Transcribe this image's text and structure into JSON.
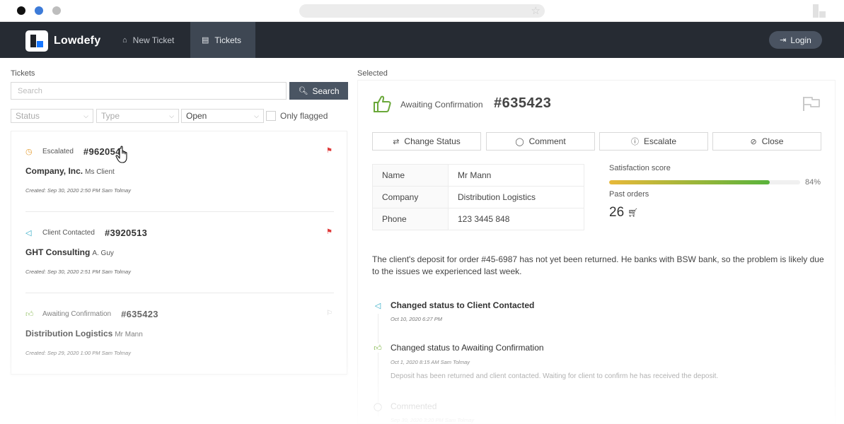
{
  "nav": {
    "brand": "Lowdefy",
    "items": [
      {
        "label": "New Ticket",
        "icon": "house-icon"
      },
      {
        "label": "Tickets",
        "icon": "document-icon"
      }
    ],
    "login_label": "Login"
  },
  "left": {
    "section_label": "Tickets",
    "search": {
      "placeholder": "Search",
      "button_label": "Search"
    },
    "filters": {
      "status_placeholder": "Status",
      "type_placeholder": "Type",
      "state_value": "Open",
      "only_flagged_label": "Only flagged"
    },
    "tickets": [
      {
        "status": "Escalated",
        "status_icon": "clock-icon",
        "status_color": "#e6a23c",
        "number": "#962054",
        "company": "Company, Inc.",
        "contact": "Ms Client",
        "created": "Created: Sep 30, 2020 2:50 PM Sam Tolmay",
        "flag_color": "#e03b3b"
      },
      {
        "status": "Client Contacted",
        "status_icon": "megaphone-icon",
        "status_color": "#2aa8c4",
        "number": "#3920513",
        "company": "GHT Consulting",
        "contact": "A. Guy",
        "created": "Created: Sep 30, 2020 2:51 PM Sam Tolmay",
        "flag_color": "#e03b3b"
      },
      {
        "status": "Awaiting Confirmation",
        "status_icon": "thumbs-up-icon",
        "status_color": "#7cb342",
        "number": "#635423",
        "company": "Distribution Logistics",
        "contact": "Mr Mann",
        "created": "Created: Sep 29, 2020 1:00 PM Sam Tolmay",
        "flag_color": "#bdbdbd"
      }
    ]
  },
  "right": {
    "section_label": "Selected",
    "status": "Awaiting Confirmation",
    "number": "#635423",
    "actions": [
      {
        "label": "Change Status",
        "icon": "swap-icon"
      },
      {
        "label": "Comment",
        "icon": "comment-icon"
      },
      {
        "label": "Escalate",
        "icon": "alert-icon"
      },
      {
        "label": "Close",
        "icon": "stop-icon"
      }
    ],
    "details": [
      {
        "key": "Name",
        "value": "Mr Mann"
      },
      {
        "key": "Company",
        "value": "Distribution Logistics"
      },
      {
        "key": "Phone",
        "value": "123 3445 848"
      }
    ],
    "satisfaction": {
      "label": "Satisfaction score",
      "percent": 84,
      "percent_text": "84%"
    },
    "past_orders": {
      "label": "Past orders",
      "value": "26"
    },
    "description": "The client's deposit for order #45-6987 has not yet been returned. He banks with BSW bank, so the problem is likely due to the issues we experienced last week.",
    "timeline": [
      {
        "title": "Changed status to Client Contacted",
        "date": "Oct 10, 2020 6:27 PM",
        "icon": "megaphone-icon",
        "color": "#2aa8c4",
        "note": ""
      },
      {
        "title": "Changed status to Awaiting Confirmation",
        "date": "Oct 1, 2020 8:15 AM Sam Tolmay",
        "icon": "thumbs-up-icon",
        "color": "#7cb342",
        "note": "Deposit has been returned and client contacted. Waiting for client to confirm he has received the deposit."
      },
      {
        "title": "Commented",
        "date": "Sep 30, 2020 3:20 PM Sam Tolmay",
        "icon": "comment-icon",
        "color": "#999999",
        "note": ""
      }
    ]
  }
}
